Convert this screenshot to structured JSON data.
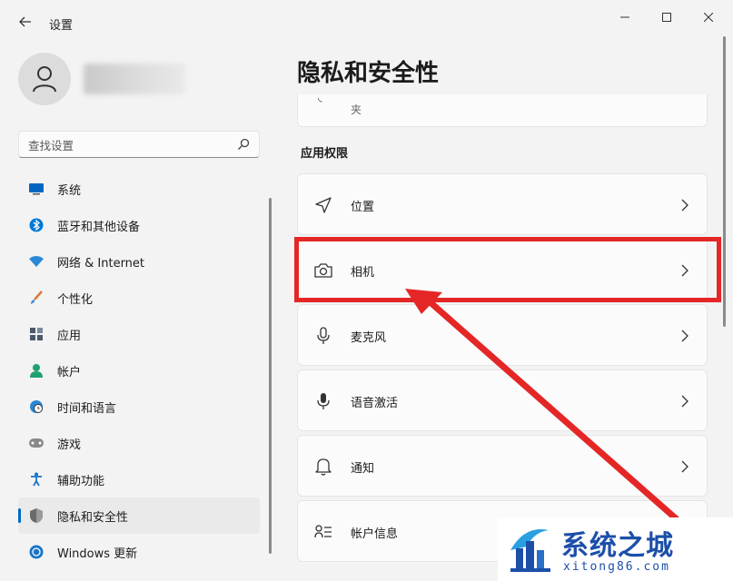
{
  "window": {
    "app_title": "设置",
    "back_icon": "arrow-left-icon",
    "controls": [
      "minimize-icon",
      "maximize-icon",
      "close-icon"
    ]
  },
  "sidebar": {
    "search_placeholder": "查找设置",
    "items": [
      {
        "label": "系统",
        "icon": "monitor-icon",
        "color": "#0067c0"
      },
      {
        "label": "蓝牙和其他设备",
        "icon": "bluetooth-icon",
        "color": "#0078d4"
      },
      {
        "label": "网络 & Internet",
        "icon": "wifi-icon",
        "color": "#2b88d8"
      },
      {
        "label": "个性化",
        "icon": "brush-icon",
        "color": "#d87a3a"
      },
      {
        "label": "应用",
        "icon": "apps-icon",
        "color": "#4a5a6a"
      },
      {
        "label": "帐户",
        "icon": "person-icon",
        "color": "#20a070"
      },
      {
        "label": "时间和语言",
        "icon": "globe-clock-icon",
        "color": "#2b88d8"
      },
      {
        "label": "游戏",
        "icon": "gamepad-icon",
        "color": "#7a7a7a"
      },
      {
        "label": "辅助功能",
        "icon": "accessibility-icon",
        "color": "#1a73c8"
      },
      {
        "label": "隐私和安全性",
        "icon": "shield-icon",
        "color": "#6a6a6a",
        "active": true
      },
      {
        "label": "Windows 更新",
        "icon": "update-icon",
        "color": "#1a73c8"
      }
    ]
  },
  "main": {
    "page_title": "隐私和安全性",
    "top_card_text": "夹",
    "section_label": "应用权限",
    "permissions": [
      {
        "label": "位置",
        "icon": "location-icon"
      },
      {
        "label": "相机",
        "icon": "camera-icon"
      },
      {
        "label": "麦克风",
        "icon": "microphone-icon"
      },
      {
        "label": "语音激活",
        "icon": "voice-activation-icon"
      },
      {
        "label": "通知",
        "icon": "bell-icon"
      },
      {
        "label": "帐户信息",
        "icon": "account-info-icon"
      }
    ]
  },
  "annotation": {
    "color": "#e52626"
  },
  "watermark": {
    "title": "系统之城",
    "url": "xitong86.com",
    "color": "#1c4fa8"
  }
}
